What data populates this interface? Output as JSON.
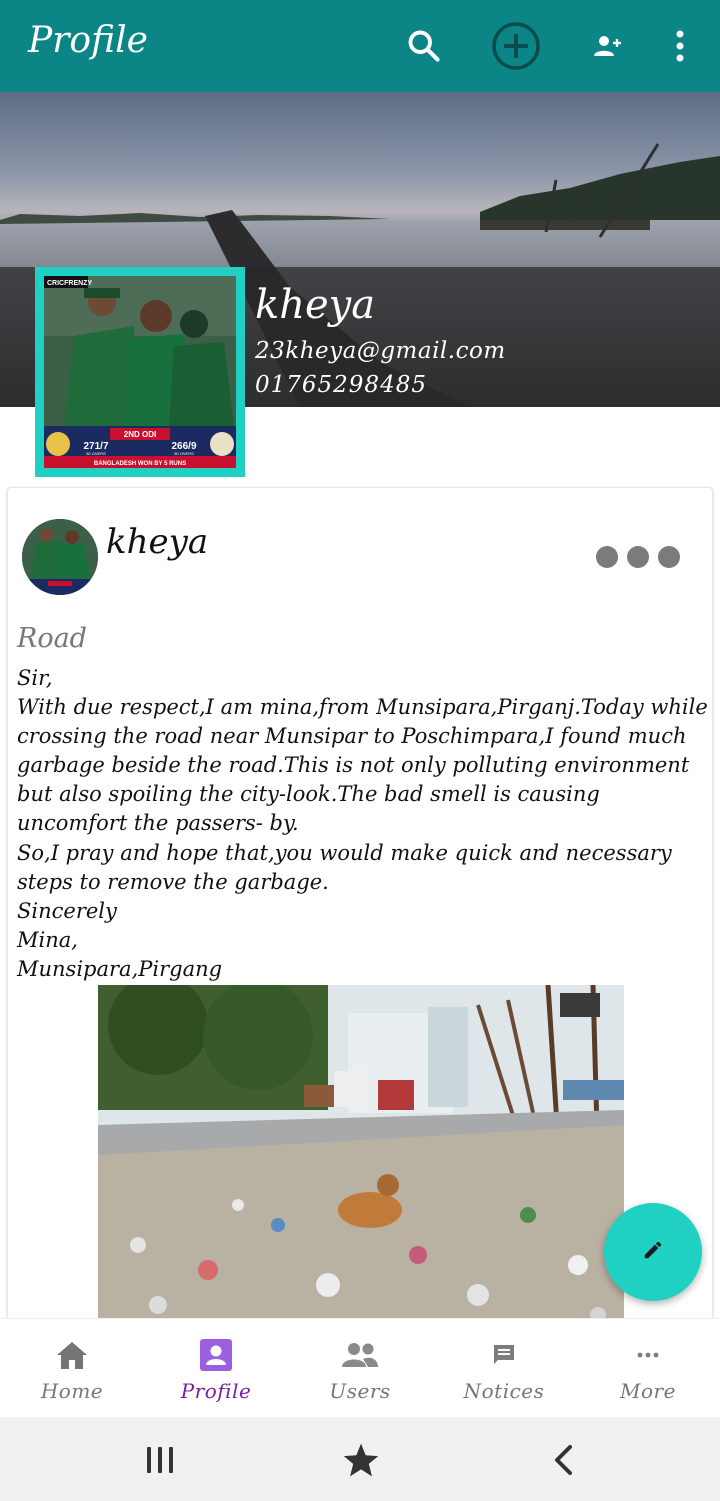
{
  "appbar": {
    "title": "Profile",
    "icons": [
      "search-icon",
      "add-circle-icon",
      "add-user-icon",
      "more-vert-icon"
    ],
    "color": "#0b8585"
  },
  "profile": {
    "name": "kheya",
    "email": "23kheya@gmail.com",
    "phone": "01765298485",
    "avatar_frame_color": "#1fd0c3",
    "avatar_text": {
      "top_left": "CRICFRENZY",
      "match": "2ND ODI",
      "score_left": "271/7",
      "score_right": "266/9",
      "overs_left": "50 OVERS",
      "overs_right": "50 OVERS",
      "result": "BANGLADESH WON BY 5 RUNS"
    }
  },
  "post": {
    "author": "kheya",
    "title": "Road",
    "body": "Sir,\nWith due respect,I am mina,from Munsipara,Pirganj.Today while crossing the road near Munsipar to Poschimpara,I found much garbage beside the road.This is not only polluting environment but also spoiling the city-look.The bad smell is causing uncomfort the passers- by.\nSo,I pray and hope that,you would make quick and necessary steps to remove the garbage.\nSincerely\nMina,\nMunsipara,Pirgang",
    "more_icon": "more-horiz-icon"
  },
  "fab": {
    "icon": "edit-pencil-icon",
    "color": "#1fd0c3"
  },
  "bottom_nav": {
    "items": [
      {
        "label": "Home",
        "icon": "home-icon"
      },
      {
        "label": "Profile",
        "icon": "profile-icon"
      },
      {
        "label": "Users",
        "icon": "users-icon"
      },
      {
        "label": "Notices",
        "icon": "notices-icon"
      },
      {
        "label": "More",
        "icon": "more-horiz-icon"
      }
    ],
    "active": "Profile",
    "active_color": "#7b1fa2"
  },
  "system_nav": {
    "icons": [
      "recents-icon",
      "home-star-icon",
      "back-icon"
    ]
  }
}
